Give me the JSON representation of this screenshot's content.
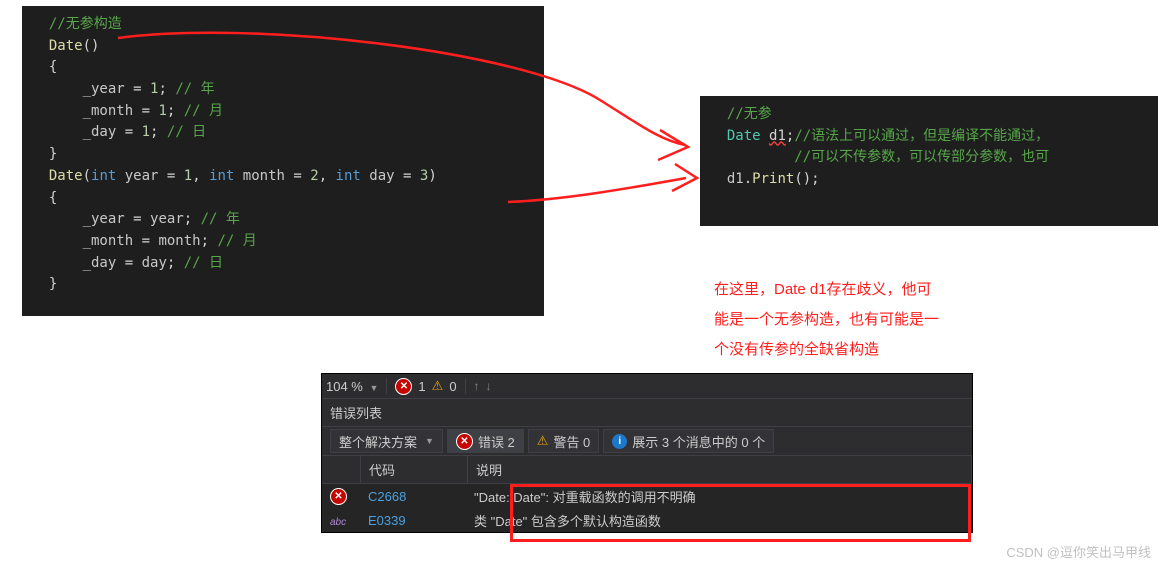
{
  "code1": {
    "c_noarg": "//无参构造",
    "date_fn": "Date",
    "year_assign": "_year",
    "month_assign": "_month",
    "day_assign": "_day",
    "one": "1",
    "c_year": "// 年",
    "c_month": "// 月",
    "c_day": "// 日",
    "int": "int",
    "p_year": "year",
    "p_month": "month",
    "p_day": "day",
    "v1": "1",
    "v2": "2",
    "v3": "3"
  },
  "code2": {
    "c_noarg": "//无参",
    "date_type": "Date",
    "d1": "d1",
    "c_line1": "//语法上可以通过，但是编译不能通过，",
    "c_line2": "//可以不传参数，可以传部分参数，也可",
    "print": "Print"
  },
  "explain": {
    "l1": "在这里，Date d1存在歧义，他可",
    "l2": "能是一个无参构造，也有可能是一",
    "l3": "个没有传参的全缺省构造"
  },
  "errorPanel": {
    "zoom": "104 %",
    "top_err_count": "1",
    "top_warn_count": "0",
    "title": "错误列表",
    "scope": "整个解决方案",
    "err_label": "错误 2",
    "warn_label": "警告 0",
    "info_label": "展示 3 个消息中的 0 个",
    "col_code": "代码",
    "col_desc": "说明",
    "rows": [
      {
        "icon": "err",
        "code": "C2668",
        "desc": "\"Date::Date\": 对重载函数的调用不明确"
      },
      {
        "icon": "abc",
        "code": "E0339",
        "desc": "类 \"Date\" 包含多个默认构造函数"
      }
    ]
  },
  "watermark": "CSDN @逗你笑出马甲线"
}
